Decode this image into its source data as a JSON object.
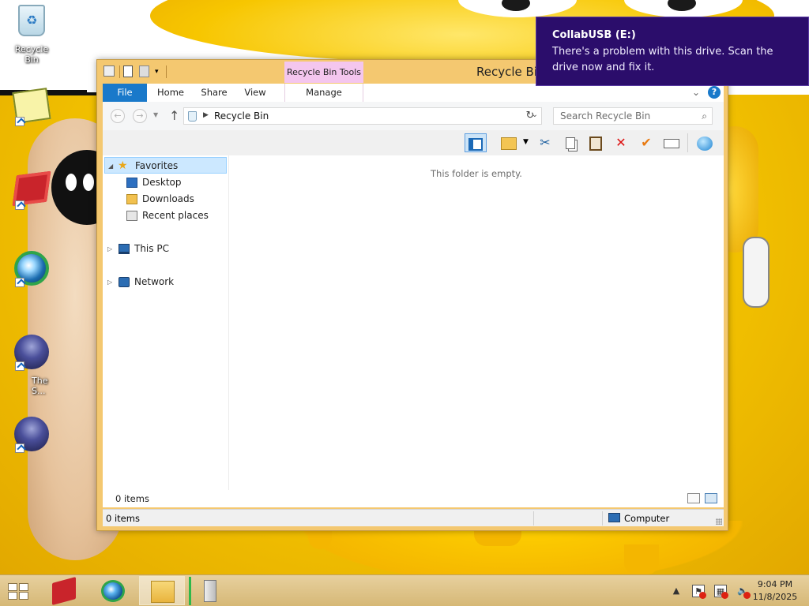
{
  "desktop": {
    "icons": [
      {
        "label": "Recycle Bin",
        "icon": "recycle-bin-icon"
      },
      {
        "label": "",
        "icon": "notepad-app-icon"
      },
      {
        "label": "",
        "icon": "red-box-app-icon"
      },
      {
        "label": "",
        "icon": "globe-browser-icon"
      },
      {
        "label": "The S...",
        "icon": "game-character-icon"
      },
      {
        "label": "",
        "icon": "game-character-icon"
      }
    ]
  },
  "window": {
    "title": "Recycle Bin",
    "contextual_tab_group": "Recycle Bin Tools",
    "ribbon_tabs": [
      "File",
      "Home",
      "Share",
      "View",
      "Manage"
    ],
    "address": {
      "path": "Recycle Bin",
      "search_placeholder": "Search Recycle Bin"
    },
    "navigation": [
      {
        "label": "Favorites",
        "icon": "star-icon",
        "selected": true
      },
      {
        "label": "Desktop",
        "icon": "desktop-folder-icon"
      },
      {
        "label": "Downloads",
        "icon": "downloads-folder-icon"
      },
      {
        "label": "Recent places",
        "icon": "recent-places-icon"
      },
      {
        "label": "This PC",
        "icon": "computer-icon"
      },
      {
        "label": "Network",
        "icon": "network-icon"
      }
    ],
    "empty_message": "This folder is empty.",
    "details_count": "0 items",
    "status": {
      "items": "0 items",
      "location": "Computer"
    }
  },
  "notification": {
    "title": "CollabUSB (E:)",
    "message": "There's a problem with this drive.  Scan the drive now and fix it."
  },
  "taskbar": {
    "apps": [
      "red-box-app-icon",
      "globe-browser-icon",
      "file-explorer-icon",
      "usb-drive-icon"
    ],
    "time": "9:04 PM",
    "date": "11/8/2025"
  },
  "colors": {
    "window_frame": "#f4c870",
    "file_tab": "#1979ca",
    "contextual_tab": "#f4c6ee",
    "toast_bg": "#2b0d6b",
    "selection": "#cce8ff"
  }
}
